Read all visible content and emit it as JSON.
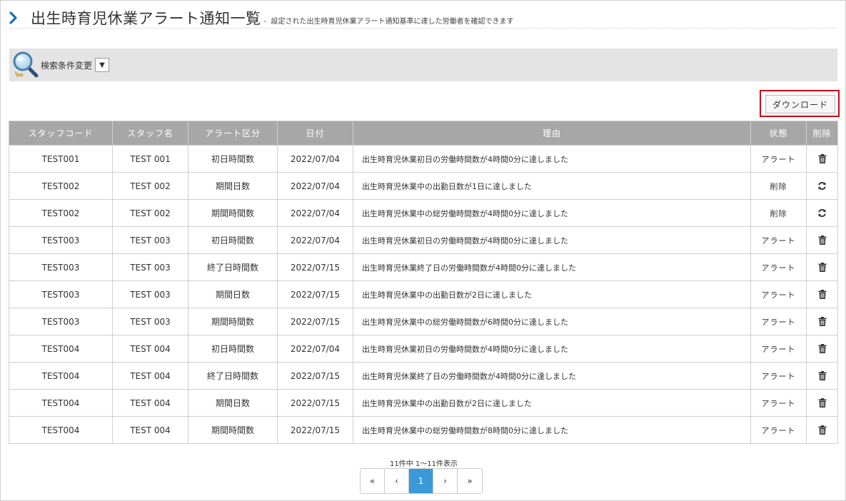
{
  "header": {
    "title": "出生時育児休業アラート通知一覧",
    "separator": "-",
    "subtitle": "設定された出生時育児休業アラート通知基準に達した労働者を確認できます"
  },
  "search": {
    "label": "検索条件変更",
    "toggle": "▼"
  },
  "toolbar": {
    "download_label": "ダウンロード"
  },
  "table": {
    "headers": [
      "スタッフコード",
      "スタッフ名",
      "アラート区分",
      "日付",
      "理由",
      "状態",
      "削除"
    ],
    "rows": [
      {
        "code": "TEST001",
        "name": "TEST 001",
        "type": "初日時間数",
        "date": "2022/07/04",
        "reason": "出生時育児休業初日の労働時間数が4時間0分に達しました",
        "status": "アラート",
        "action": "trash"
      },
      {
        "code": "TEST002",
        "name": "TEST 002",
        "type": "期間日数",
        "date": "2022/07/04",
        "reason": "出生時育児休業中の出勤日数が1日に達しました",
        "status": "削除",
        "action": "restore"
      },
      {
        "code": "TEST002",
        "name": "TEST 002",
        "type": "期間時間数",
        "date": "2022/07/04",
        "reason": "出生時育児休業中の総労働時間数が4時間0分に達しました",
        "status": "削除",
        "action": "restore"
      },
      {
        "code": "TEST003",
        "name": "TEST 003",
        "type": "初日時間数",
        "date": "2022/07/04",
        "reason": "出生時育児休業初日の労働時間数が4時間0分に達しました",
        "status": "アラート",
        "action": "trash"
      },
      {
        "code": "TEST003",
        "name": "TEST 003",
        "type": "終了日時間数",
        "date": "2022/07/15",
        "reason": "出生時育児休業終了日の労働時間数が4時間0分に達しました",
        "status": "アラート",
        "action": "trash"
      },
      {
        "code": "TEST003",
        "name": "TEST 003",
        "type": "期間日数",
        "date": "2022/07/15",
        "reason": "出生時育児休業中の出勤日数が2日に達しました",
        "status": "アラート",
        "action": "trash"
      },
      {
        "code": "TEST003",
        "name": "TEST 003",
        "type": "期間時間数",
        "date": "2022/07/15",
        "reason": "出生時育児休業中の総労働時間数が6時間0分に達しました",
        "status": "アラート",
        "action": "trash"
      },
      {
        "code": "TEST004",
        "name": "TEST 004",
        "type": "初日時間数",
        "date": "2022/07/04",
        "reason": "出生時育児休業初日の労働時間数が4時間0分に達しました",
        "status": "アラート",
        "action": "trash"
      },
      {
        "code": "TEST004",
        "name": "TEST 004",
        "type": "終了日時間数",
        "date": "2022/07/15",
        "reason": "出生時育児休業終了日の労働時間数が4時間0分に達しました",
        "status": "アラート",
        "action": "trash"
      },
      {
        "code": "TEST004",
        "name": "TEST 004",
        "type": "期間日数",
        "date": "2022/07/15",
        "reason": "出生時育児休業中の出勤日数が2日に達しました",
        "status": "アラート",
        "action": "trash"
      },
      {
        "code": "TEST004",
        "name": "TEST 004",
        "type": "期間時間数",
        "date": "2022/07/15",
        "reason": "出生時育児休業中の総労働時間数が8時間0分に達しました",
        "status": "アラート",
        "action": "trash"
      }
    ]
  },
  "pagination": {
    "info": "11件中 1〜11件表示",
    "first": "«",
    "prev": "‹",
    "current": "1",
    "next": "›",
    "last": "»"
  },
  "colors": {
    "header_bg": "#a7a7a7",
    "search_bar_bg": "#e4e4e4",
    "active_page": "#3a9ad9",
    "download_highlight": "#d0021b",
    "title_chevron": "#1a6fb5"
  },
  "icons": {
    "title": "chevron-right-icon",
    "search": "magnifier-icon",
    "delete": "trash-icon",
    "restore": "refresh-icon"
  }
}
